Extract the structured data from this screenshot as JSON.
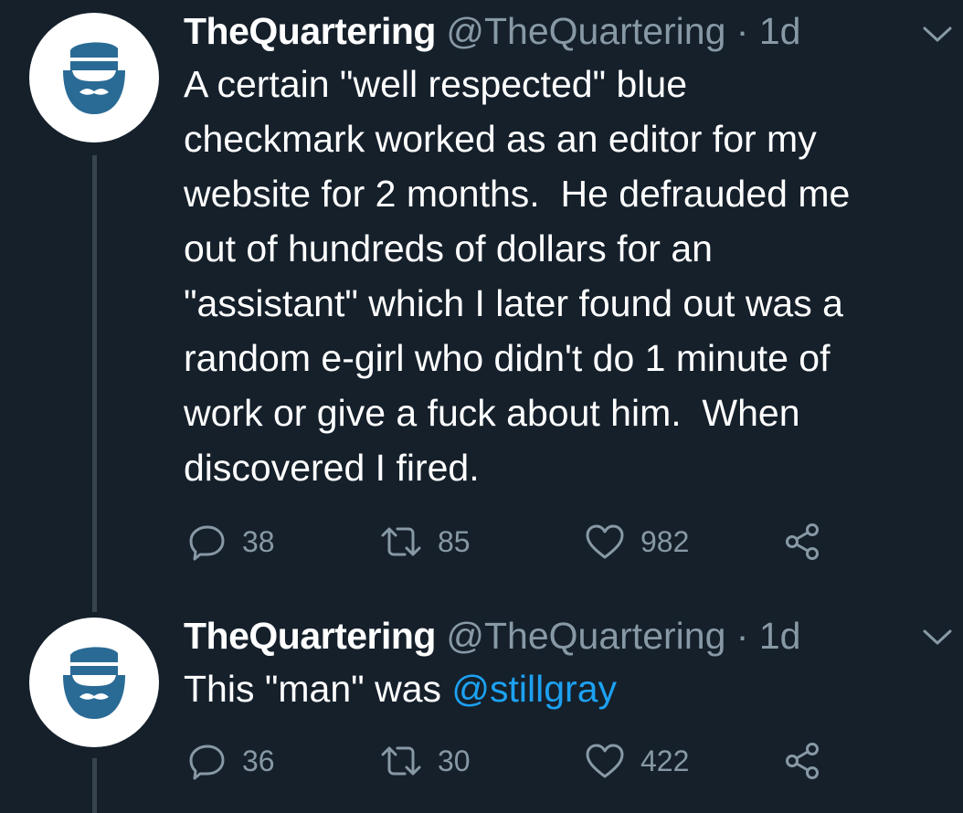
{
  "tweets": [
    {
      "display_name": "TheQuartering",
      "handle": "@TheQuartering",
      "separator": "·",
      "time": "1d",
      "text": "A certain \"well respected\" blue\ncheckmark worked as an editor for my\nwebsite for 2 months.  He defrauded me\nout of hundreds of dollars for an\n\"assistant\" which I later found out was a\nrandom e-girl who didn't do 1 minute of\nwork or give a fuck about him.  When\ndiscovered I fired.",
      "replies": "38",
      "retweets": "85",
      "likes": "982"
    },
    {
      "display_name": "TheQuartering",
      "handle": "@TheQuartering",
      "separator": "·",
      "time": "1d",
      "text_prefix": "This \"man\" was ",
      "mention": "@stillgray",
      "replies": "36",
      "retweets": "30",
      "likes": "422"
    }
  ],
  "icons": {
    "avatar": "bearded-man-logo",
    "menu": "chevron-down-icon",
    "reply": "reply-icon",
    "retweet": "retweet-icon",
    "like": "heart-icon",
    "share": "share-icon"
  },
  "colors": {
    "background": "#15202b",
    "text": "#ffffff",
    "secondary": "#8899a6",
    "accent": "#1da1f2",
    "logo": "#2a6b96",
    "thread_line": "#38444d"
  }
}
